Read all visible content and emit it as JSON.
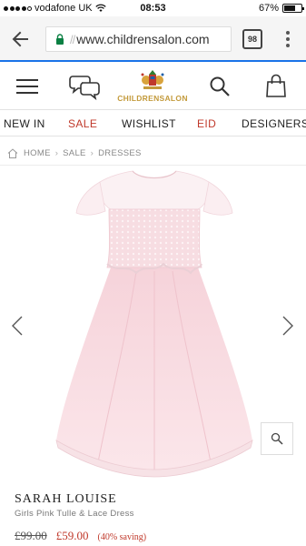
{
  "status_bar": {
    "carrier": "vodafone UK",
    "time": "08:53",
    "battery_percent": "67%",
    "battery_level": 0.67
  },
  "browser": {
    "url_prefix": "//",
    "url": "www.childrensalon.com",
    "tab_count": "98"
  },
  "site": {
    "logo_text": "CHILDRENSALON"
  },
  "nav": {
    "items": [
      {
        "label": "NEW IN"
      },
      {
        "label": "SALE"
      },
      {
        "label": "WISHLIST"
      },
      {
        "label": "EID"
      },
      {
        "label": "DESIGNERS"
      }
    ]
  },
  "breadcrumb": {
    "items": [
      "HOME",
      "SALE",
      "DRESSES"
    ]
  },
  "product": {
    "brand": "SARAH LOUISE",
    "name": "Girls Pink Tulle & Lace Dress",
    "old_price": "£99.00",
    "new_price": "£59.00",
    "saving": "(40% saving)"
  },
  "colors": {
    "accent_red": "#c0392b",
    "browser_accent": "#1a73e8",
    "logo_gold": "#c39a3b",
    "dress_pink": "#f6d6dc"
  }
}
